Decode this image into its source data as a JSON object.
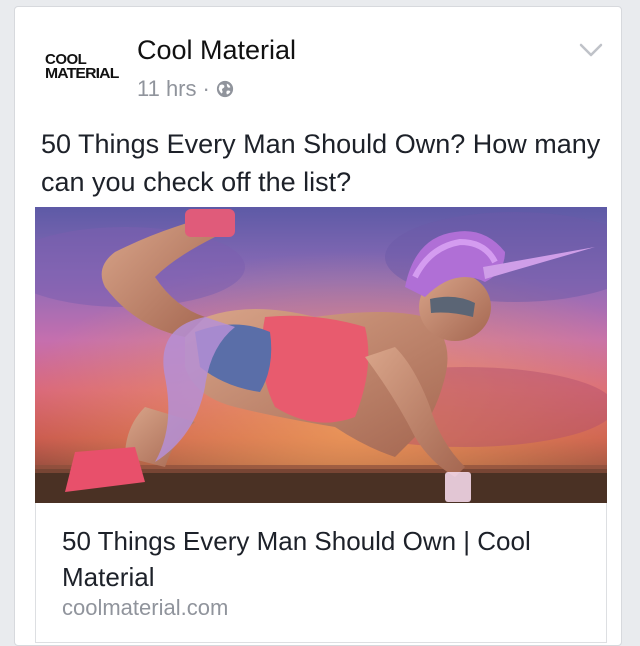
{
  "post": {
    "page_name": "Cool Material",
    "logo_line1": "COOL",
    "logo_line2": "MATERIAL",
    "timestamp": "11 hrs",
    "separator": "·",
    "privacy_icon": "globe-icon",
    "menu_icon": "chevron-down-icon",
    "text": "50 Things Every Man Should Own? How many can you check off the list?"
  },
  "link_preview": {
    "title": "50 Things Every Man Should Own | Cool Material",
    "domain": "coolmaterial.com"
  },
  "colors": {
    "background": "#e9ebee",
    "card": "#ffffff",
    "text": "#1d2129",
    "meta": "#90949c"
  }
}
